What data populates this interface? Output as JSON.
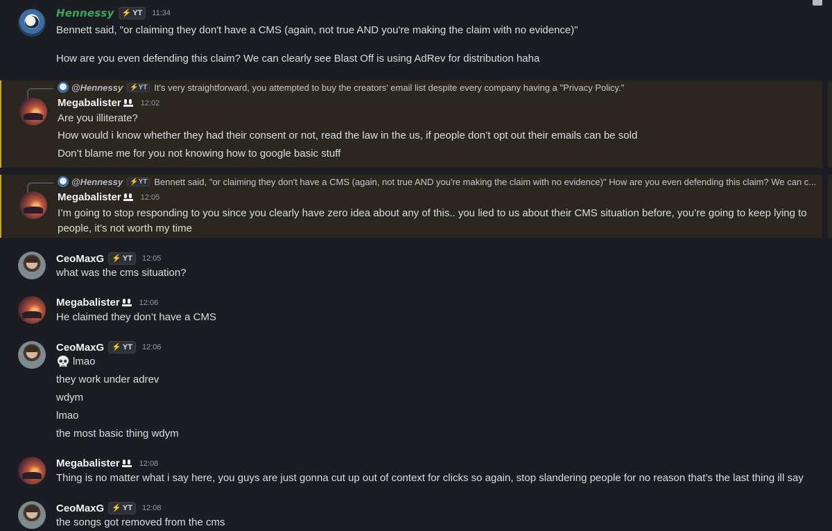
{
  "badge_label": "YT",
  "messages": [
    {
      "author": "Hennessy",
      "time": "11:34",
      "lines": [
        "Bennett said, \"or claiming they don't have a CMS (again, not true AND you're making the claim with no evidence)\"",
        "How are you even defending this claim? We can clearly see Blast Off is using AdRev for distribution haha"
      ]
    },
    {
      "reply_to": "@Hennessy",
      "reply_text": "It's very straightforward, you attempted to buy the creators' email list despite every company having a \"Privacy Policy.\"",
      "author": "Megabalister",
      "time": "12:02",
      "lines": [
        "Are you illiterate?",
        "How would i know whether they had their consent or not, read the law in the us, if people don’t opt out their emails can be sold",
        "Don’t blame me for you not knowing how to google basic stuff"
      ]
    },
    {
      "reply_to": "@Hennessy",
      "reply_text": "Bennett said, \"or claiming they don't have a CMS (again, not true AND you're making the claim with no evidence)\"  How are you even defending this claim? We can c...",
      "author": "Megabalister",
      "time": "12:05",
      "lines": [
        "I’m going to stop responding to you since you clearly have zero idea about any of this.. you lied to us about their CMS situation before, you’re going to keep lying to",
        "people, it’s not worth my time"
      ]
    },
    {
      "author": "CeoMaxG",
      "time": "12:05",
      "lines": [
        "what was the cms situation?"
      ]
    },
    {
      "author": "Megabalister",
      "time": "12:06",
      "lines": [
        "He claimed they don’t have a CMS"
      ]
    },
    {
      "author": "CeoMaxG",
      "time": "12:06",
      "lines": [
        "lmao",
        "they work under adrev",
        "wdym",
        "lmao",
        "the most basic thing wdym"
      ]
    },
    {
      "author": "Megabalister",
      "time": "12:08",
      "lines": [
        "Thing is no matter what i say here, you guys are just gonna cut up out of context for clicks so again, stop slandering people for no reason that’s the last thing ill say"
      ]
    },
    {
      "author": "CeoMaxG",
      "time": "12:08",
      "lines": [
        "the songs got removed from the cms"
      ]
    }
  ]
}
